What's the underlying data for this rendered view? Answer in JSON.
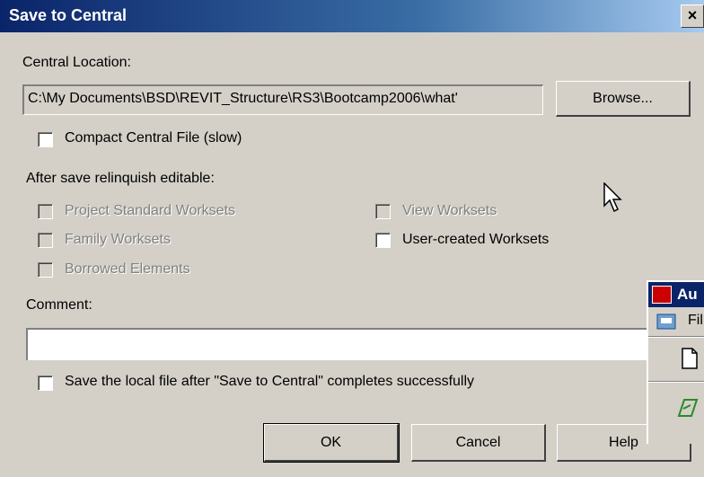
{
  "dialog": {
    "title": "Save to Central",
    "close_label": "×"
  },
  "central_location": {
    "label": "Central Location:",
    "path": "C:\\My Documents\\BSD\\REVIT_Structure\\RS3\\Bootcamp2006\\what'",
    "browse_label": "Browse..."
  },
  "compact": {
    "label": "Compact Central File (slow)",
    "checked": false
  },
  "relinquish": {
    "label": "After save relinquish editable:",
    "project_standard": "Project Standard Worksets",
    "family": "Family Worksets",
    "borrowed": "Borrowed Elements",
    "view": "View Worksets",
    "user_created": "User-created Worksets"
  },
  "comment": {
    "label": "Comment:",
    "value": ""
  },
  "save_local": {
    "label": "Save the local file after \"Save to Central\" completes successfully",
    "checked": false
  },
  "buttons": {
    "ok": "OK",
    "cancel": "Cancel",
    "help": "Help"
  },
  "background_window": {
    "title": "Au",
    "menu_file": "Fil"
  },
  "colors": {
    "titlebar_start": "#0a246a",
    "titlebar_end": "#a6caf0",
    "face": "#d4d0c8"
  }
}
